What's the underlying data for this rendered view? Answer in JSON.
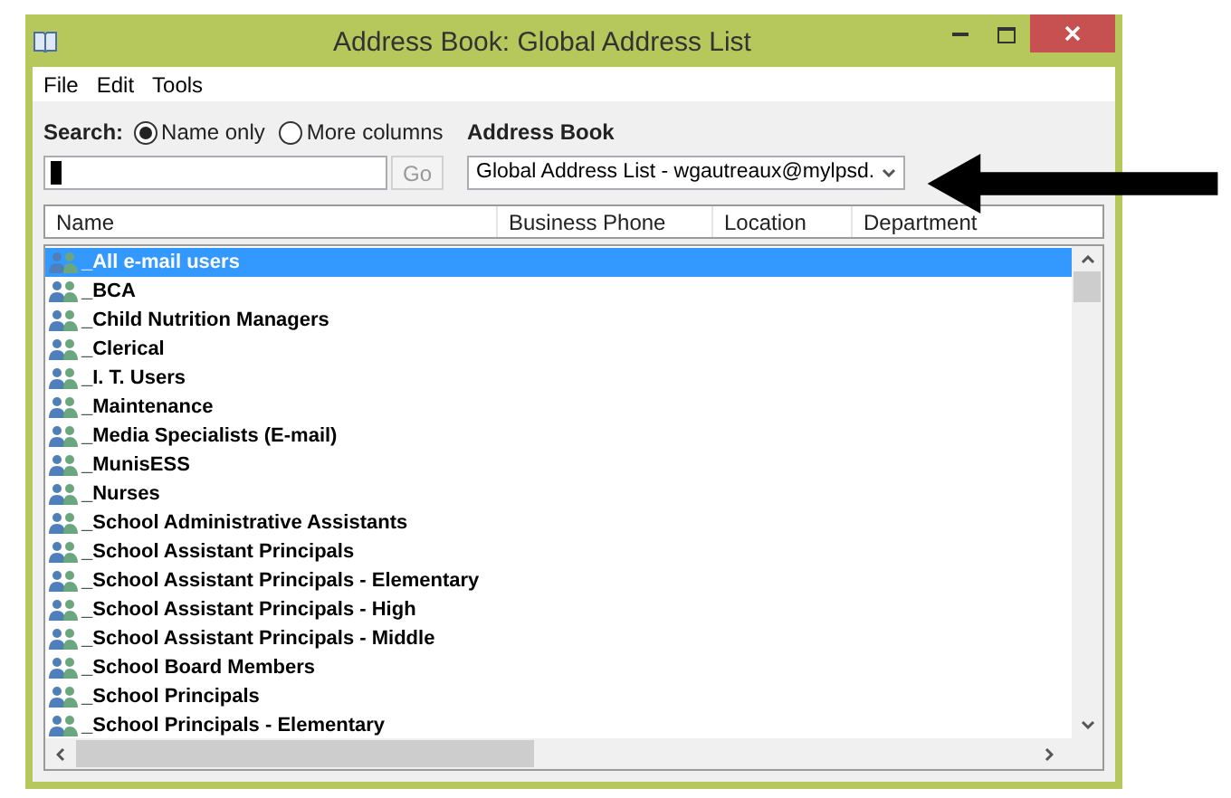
{
  "window": {
    "title": "Address Book: Global Address List"
  },
  "menu": [
    "File",
    "Edit",
    "Tools"
  ],
  "search": {
    "label": "Search:",
    "options": [
      {
        "label": "Name only",
        "selected": true
      },
      {
        "label": "More columns",
        "selected": false
      }
    ],
    "go_button": {
      "label": "Go",
      "disabled": true
    }
  },
  "address_book": {
    "label": "Address Book",
    "value": "Global Address List - wgautreaux@mylpsd."
  },
  "table": {
    "columns": [
      "Name",
      "Business Phone",
      "Location",
      "Department"
    ],
    "rows": [
      {
        "name": "_All e-mail users",
        "selected": true
      },
      {
        "name": "_BCA",
        "selected": false
      },
      {
        "name": "_Child Nutrition Managers",
        "selected": false
      },
      {
        "name": "_Clerical",
        "selected": false
      },
      {
        "name": "_I. T. Users",
        "selected": false
      },
      {
        "name": "_Maintenance",
        "selected": false
      },
      {
        "name": "_Media Specialists (E-mail)",
        "selected": false
      },
      {
        "name": "_MunisESS",
        "selected": false
      },
      {
        "name": "_Nurses",
        "selected": false
      },
      {
        "name": "_School Administrative Assistants",
        "selected": false
      },
      {
        "name": "_School Assistant Principals",
        "selected": false
      },
      {
        "name": "_School Assistant Principals - Elementary",
        "selected": false
      },
      {
        "name": "_School Assistant Principals - High",
        "selected": false
      },
      {
        "name": "_School Assistant Principals - Middle",
        "selected": false
      },
      {
        "name": "_School Board Members",
        "selected": false
      },
      {
        "name": "_School Principals",
        "selected": false
      },
      {
        "name": "_School Principals - Elementary",
        "selected": false
      }
    ]
  }
}
